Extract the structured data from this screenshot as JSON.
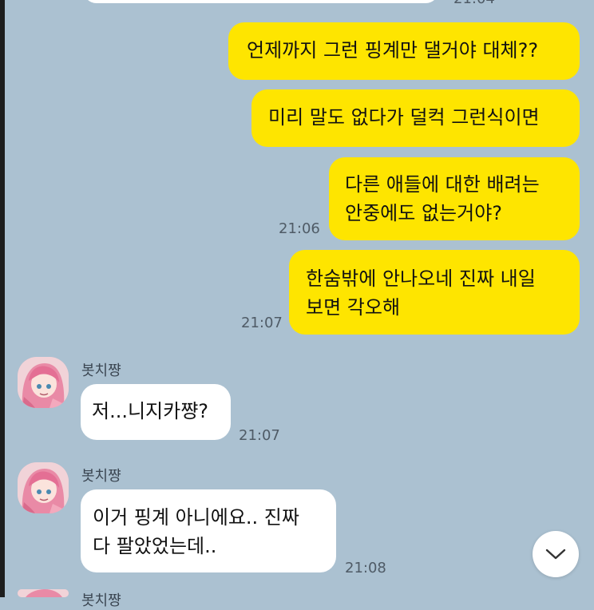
{
  "chat": {
    "top_time_partial": "21:04",
    "my_messages": [
      {
        "lines": [
          "언제까지 그런 핑계만 댈거야 대체??"
        ]
      },
      {
        "lines": [
          "미리 말도 없다가 덜컥 그런식이면"
        ]
      },
      {
        "lines": [
          "다른 애들에 대한 배려는",
          "안중에도 없는거야?"
        ],
        "time": "21:06"
      },
      {
        "lines": [
          "한숨밖에 안나오네 진짜 내일",
          "보면 각오해"
        ],
        "time": "21:07"
      }
    ],
    "their_messages": [
      {
        "sender": "봇치쨩",
        "lines": [
          "저...니지카쨩?"
        ],
        "time": "21:07"
      },
      {
        "sender": "봇치쨩",
        "lines": [
          "이거 핑계 아니에요.. 진짜",
          "다 팔았었는데.."
        ],
        "time": "21:08"
      }
    ],
    "bottom_sender_partial": "봇치쨩"
  },
  "icons": {
    "scroll_down": "chevron-down-icon",
    "avatar": "pink-haired-anime-girl-avatar"
  }
}
